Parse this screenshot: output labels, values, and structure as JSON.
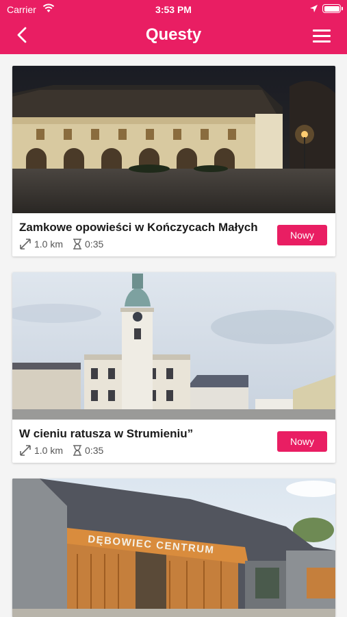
{
  "status_bar": {
    "carrier": "Carrier",
    "time": "3:53 PM"
  },
  "nav": {
    "title": "Questy",
    "back_icon": "chevron-left-icon",
    "menu_icon": "hamburger-menu-icon"
  },
  "colors": {
    "accent": "#e91e63",
    "background": "#f4f4f4",
    "card": "#ffffff"
  },
  "quests": [
    {
      "title": "Zamkowe opowieści w Kończycach Małych",
      "distance": "1.0 km",
      "duration": "0:35",
      "badge": "Nowy"
    },
    {
      "title": "W cieniu ratusza w Strumieniu”",
      "distance": "1.0 km",
      "duration": "0:35",
      "badge": "Nowy"
    },
    {
      "title": "",
      "distance": "",
      "duration": "",
      "badge": "",
      "image_sign": "DĘBOWIEC CENTRUM"
    }
  ]
}
